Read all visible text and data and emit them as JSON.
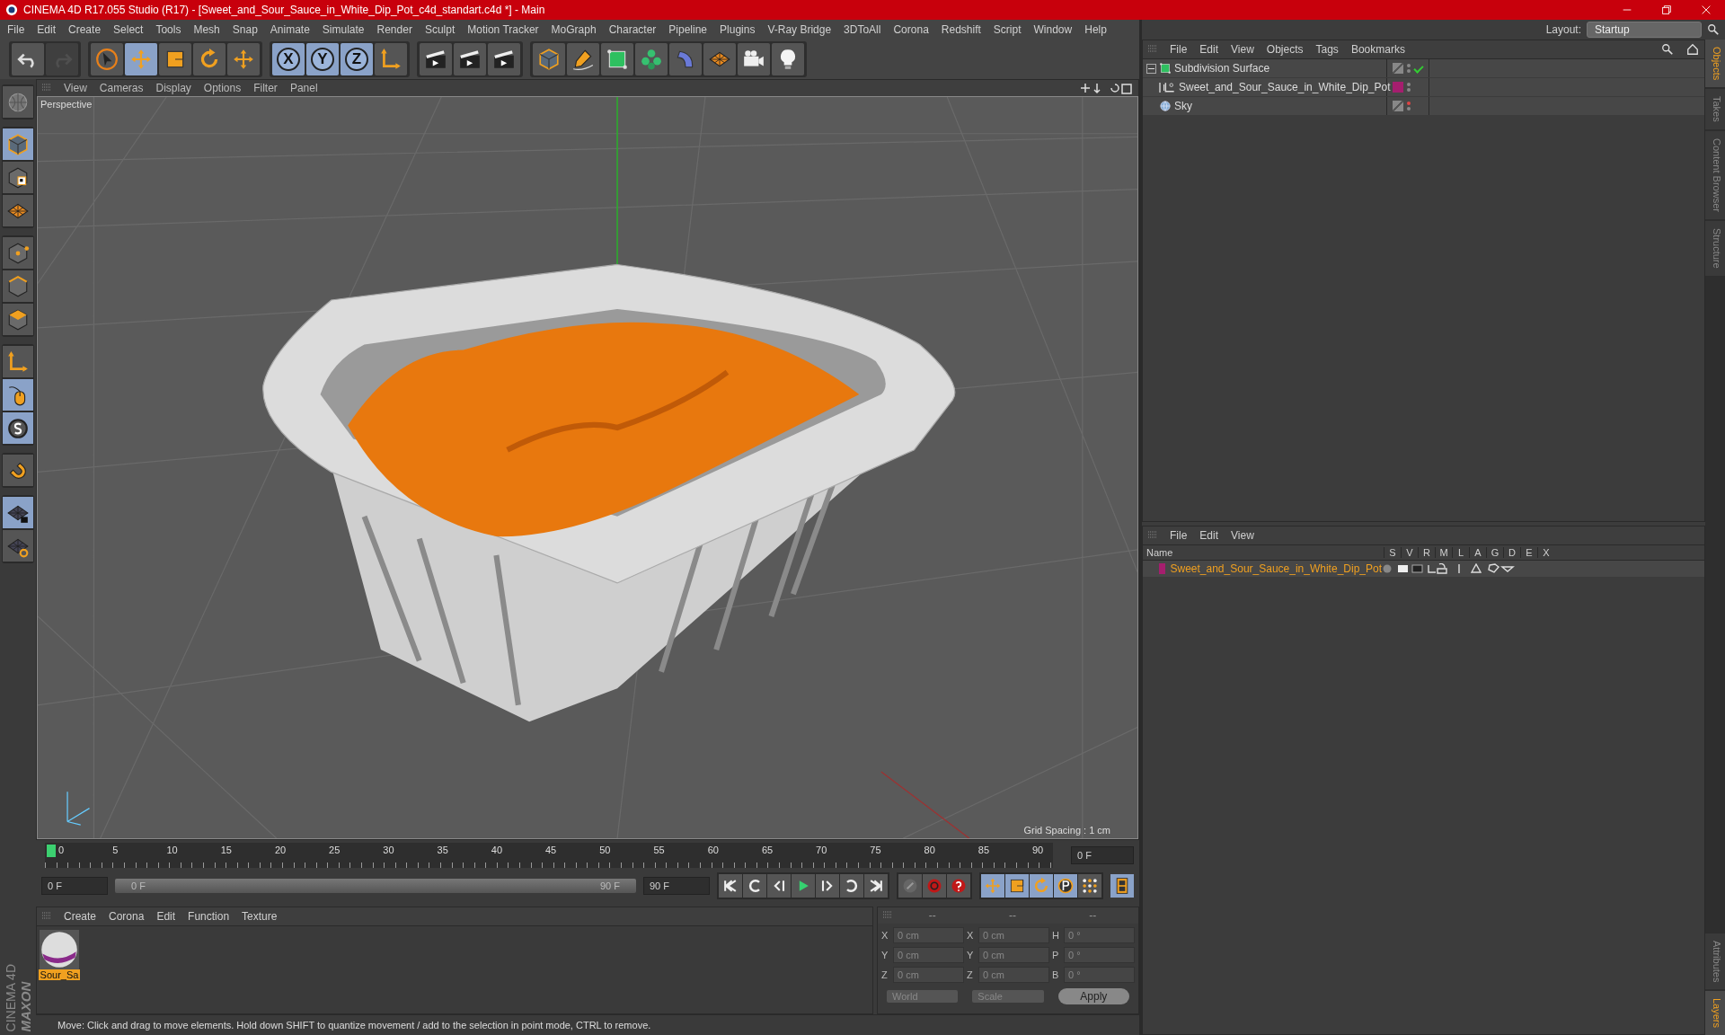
{
  "window": {
    "title": "CINEMA 4D R17.055 Studio (R17) - [Sweet_and_Sour_Sauce_in_White_Dip_Pot_c4d_standart.c4d *] - Main"
  },
  "menu_bar": [
    "File",
    "Edit",
    "Create",
    "Select",
    "Tools",
    "Mesh",
    "Snap",
    "Animate",
    "Simulate",
    "Render",
    "Sculpt",
    "Motion Tracker",
    "MoGraph",
    "Character",
    "Pipeline",
    "Plugins",
    "V-Ray Bridge",
    "3DToAll",
    "Corona",
    "Redshift",
    "Script",
    "Window",
    "Help"
  ],
  "layout": {
    "label": "Layout:",
    "value": "Startup"
  },
  "toolbar": [
    [
      {
        "kind": "undo",
        "selected": false,
        "disabled": false
      },
      {
        "kind": "redo",
        "selected": false,
        "disabled": true
      }
    ],
    [
      {
        "kind": "cursor",
        "selected": false,
        "disabled": false
      },
      {
        "kind": "move",
        "selected": true,
        "disabled": false
      },
      {
        "kind": "scale",
        "selected": false,
        "disabled": false
      },
      {
        "kind": "rotate",
        "selected": false,
        "disabled": false
      },
      {
        "kind": "transform",
        "selected": false,
        "disabled": false
      }
    ],
    [
      {
        "kind": "axis",
        "label": "X",
        "selected": true,
        "disabled": false
      },
      {
        "kind": "axis",
        "label": "Y",
        "selected": true,
        "disabled": false
      },
      {
        "kind": "axis",
        "label": "Z",
        "selected": true,
        "disabled": false
      },
      {
        "kind": "coord",
        "selected": false,
        "disabled": false
      }
    ],
    [
      {
        "kind": "clapper",
        "selected": false,
        "disabled": false
      },
      {
        "kind": "clapper",
        "selected": false,
        "disabled": false
      },
      {
        "kind": "clapper",
        "selected": false,
        "disabled": false
      }
    ],
    [
      {
        "kind": "cube",
        "selected": false,
        "disabled": false
      },
      {
        "kind": "pen",
        "selected": false,
        "disabled": false
      },
      {
        "kind": "subdiv",
        "selected": false,
        "disabled": false
      },
      {
        "kind": "cloner",
        "selected": false,
        "disabled": false
      },
      {
        "kind": "deformer",
        "selected": false,
        "disabled": false
      },
      {
        "kind": "floor",
        "selected": false,
        "disabled": false
      },
      {
        "kind": "camera",
        "selected": false,
        "disabled": false
      },
      {
        "kind": "light",
        "selected": false,
        "disabled": false
      }
    ]
  ],
  "left_toolbar": [
    [
      {
        "kind": "globe",
        "selected": false
      }
    ],
    [
      {
        "kind": "cube",
        "selected": true
      },
      {
        "kind": "checker",
        "selected": false
      },
      {
        "kind": "floor",
        "selected": false
      }
    ],
    [
      {
        "kind": "points",
        "selected": false
      },
      {
        "kind": "edges",
        "selected": false
      },
      {
        "kind": "polygons",
        "selected": false
      }
    ],
    [
      {
        "kind": "axis-l",
        "selected": false
      },
      {
        "kind": "mouse",
        "selected": true
      },
      {
        "kind": "snap",
        "selected": true
      }
    ],
    [
      {
        "kind": "magnet",
        "selected": false
      }
    ],
    [
      {
        "kind": "grid-lock",
        "selected": true
      },
      {
        "kind": "grid-rotate",
        "selected": false
      }
    ]
  ],
  "viewport": {
    "menu": [
      "View",
      "Cameras",
      "Display",
      "Options",
      "Filter",
      "Panel"
    ],
    "camera": "Perspective",
    "grid_spacing": "Grid Spacing : 1 cm"
  },
  "timeline": {
    "ticks": [
      "0",
      "5",
      "10",
      "15",
      "20",
      "25",
      "30",
      "35",
      "40",
      "45",
      "50",
      "55",
      "60",
      "65",
      "70",
      "75",
      "80",
      "85",
      "90"
    ],
    "current_frame": "0 F",
    "start_field": "0 F",
    "range": {
      "start": "0 F",
      "end": "90 F"
    },
    "end_field": "90 F",
    "transport": [
      {
        "kind": "first",
        "selected": false
      },
      {
        "kind": "loop-left",
        "selected": false
      },
      {
        "kind": "prev",
        "selected": false
      },
      {
        "kind": "play",
        "selected": false
      },
      {
        "kind": "next",
        "selected": false
      },
      {
        "kind": "loop-right",
        "selected": false
      },
      {
        "kind": "last",
        "selected": false
      }
    ],
    "keys": [
      {
        "kind": "key-off",
        "selected": false
      },
      {
        "kind": "record",
        "selected": false
      },
      {
        "kind": "help",
        "selected": false
      }
    ],
    "key_tracks": [
      {
        "kind": "move",
        "selected": true
      },
      {
        "kind": "scale",
        "selected": true
      },
      {
        "kind": "rotate",
        "selected": true
      },
      {
        "kind": "param",
        "selected": true
      },
      {
        "kind": "dots",
        "selected": false
      }
    ],
    "film": {
      "kind": "film",
      "selected": true
    }
  },
  "materials": {
    "menu": [
      "Create",
      "Corona",
      "Edit",
      "Function",
      "Texture"
    ],
    "items": [
      {
        "name": "Sour_Sa",
        "selected": true
      }
    ]
  },
  "coordinates": {
    "headers": [
      "--",
      "--",
      "--"
    ],
    "rows": [
      {
        "axis": "X",
        "position": "0 cm",
        "size_axis": "X",
        "size": "0 cm",
        "rot_axis": "H",
        "rotation": "0 °"
      },
      {
        "axis": "Y",
        "position": "0 cm",
        "size_axis": "Y",
        "size": "0 cm",
        "rot_axis": "P",
        "rotation": "0 °"
      },
      {
        "axis": "Z",
        "position": "0 cm",
        "size_axis": "Z",
        "size": "0 cm",
        "rot_axis": "B",
        "rotation": "0 °"
      }
    ],
    "mode": "World",
    "transform": "Scale",
    "apply": "Apply"
  },
  "logo": {
    "brand": "MAXON",
    "product": "CINEMA 4D"
  },
  "status_bar": "Move: Click and drag to move elements. Hold down SHIFT to quantize movement / add to the selection in point mode, CTRL to remove.",
  "object_manager": {
    "menu": [
      "File",
      "Edit",
      "View",
      "Objects",
      "Tags",
      "Bookmarks"
    ],
    "objects": [
      {
        "name": "Subdivision Surface",
        "kind": "subdiv",
        "expanded": true,
        "enabled": true,
        "editor_off": false,
        "children": [
          {
            "name": "Sweet_and_Sour_Sauce_in_White_Dip_Pot",
            "kind": "null",
            "expanded": false,
            "editor_off": false,
            "color": "#a51e6e"
          }
        ]
      },
      {
        "name": "Sky",
        "kind": "sky",
        "editor_off": true
      }
    ]
  },
  "layer_manager": {
    "menu": [
      "File",
      "Edit",
      "View"
    ],
    "columns": [
      "Name",
      "S",
      "V",
      "R",
      "M",
      "L",
      "A",
      "G",
      "D",
      "E",
      "X"
    ],
    "layers": [
      {
        "name": "Sweet_and_Sour_Sauce_in_White_Dip_Pot",
        "color": "#a51e6e"
      }
    ]
  },
  "side_tabs_top": [
    {
      "label": "Objects",
      "selected": true
    },
    {
      "label": "Takes",
      "selected": false
    },
    {
      "label": "Content Browser",
      "selected": false
    },
    {
      "label": "Structure",
      "selected": false
    }
  ],
  "side_tabs_bottom": [
    {
      "label": "Attributes",
      "selected": false
    },
    {
      "label": "Layers",
      "selected": true
    }
  ]
}
